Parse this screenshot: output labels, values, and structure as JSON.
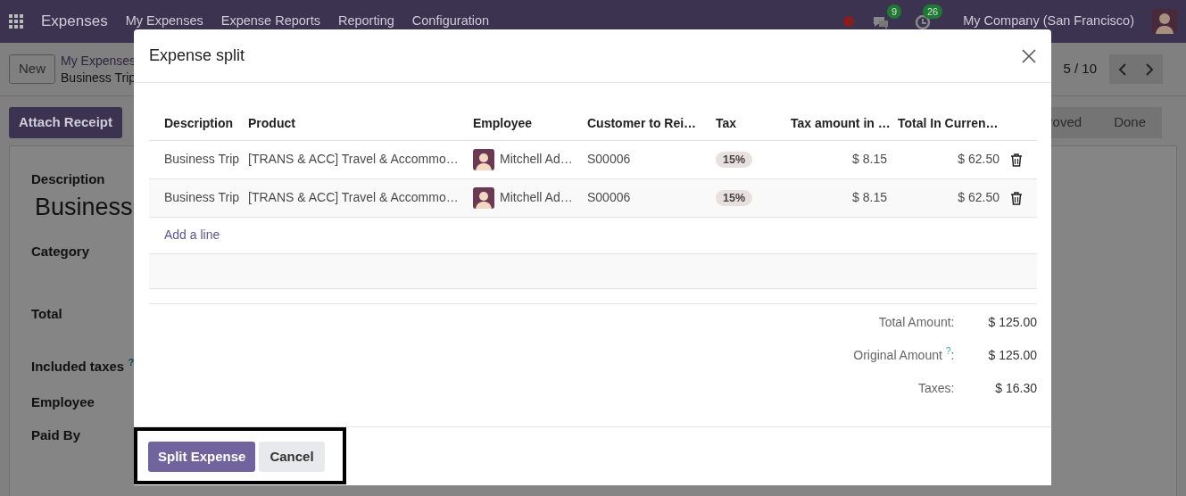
{
  "navbar": {
    "app": "Expenses",
    "menu": [
      "My Expenses",
      "Expense Reports",
      "Reporting",
      "Configuration"
    ],
    "messages_count": "9",
    "activities_count": "26",
    "company": "My Company (San Francisco)"
  },
  "control_panel": {
    "new_button": "New",
    "breadcrumb": [
      "My Expenses",
      "Business Trip"
    ],
    "pager": "5 / 10"
  },
  "action_button": "Attach Receipt",
  "status_stages": [
    {
      "label": "roved",
      "selected": false
    },
    {
      "label": "Done",
      "selected": false
    }
  ],
  "form": {
    "description_label": "Description",
    "title": "Business",
    "fields": [
      "Category",
      "Total",
      "Included taxes $^{?}$",
      "Employee",
      "Paid By"
    ]
  },
  "dialog": {
    "title": "Expense split",
    "columns": [
      "Description",
      "Product",
      "Employee",
      "Customer to Rei…",
      "Tax",
      "Tax amount in …",
      "Total In Curren…"
    ],
    "rows": [
      {
        "description": "Business Trip",
        "product": "[TRANS & ACC] Travel & Accommo…",
        "employee": "Mitchell Ad…",
        "customer": "S00006",
        "tax": "15%",
        "tax_amount": "$ 8.15",
        "total": "$ 62.50"
      },
      {
        "description": "Business Trip",
        "product": "[TRANS & ACC] Travel & Accommo…",
        "employee": "Mitchell Ad…",
        "customer": "S00006",
        "tax": "15%",
        "tax_amount": "$ 8.15",
        "total": "$ 62.50"
      }
    ],
    "add_line": "Add a line",
    "totals": [
      {
        "label": "Total Amount:",
        "value": "$ 125.00"
      },
      {
        "label": "Original Amount $^{?}$:",
        "value": "$ 125.00"
      },
      {
        "label": "Taxes:",
        "value": "$ 16.30"
      }
    ],
    "buttons": [
      {
        "label": "Split Expense",
        "kind": "primary"
      },
      {
        "label": "Cancel",
        "kind": "secondary"
      }
    ]
  }
}
